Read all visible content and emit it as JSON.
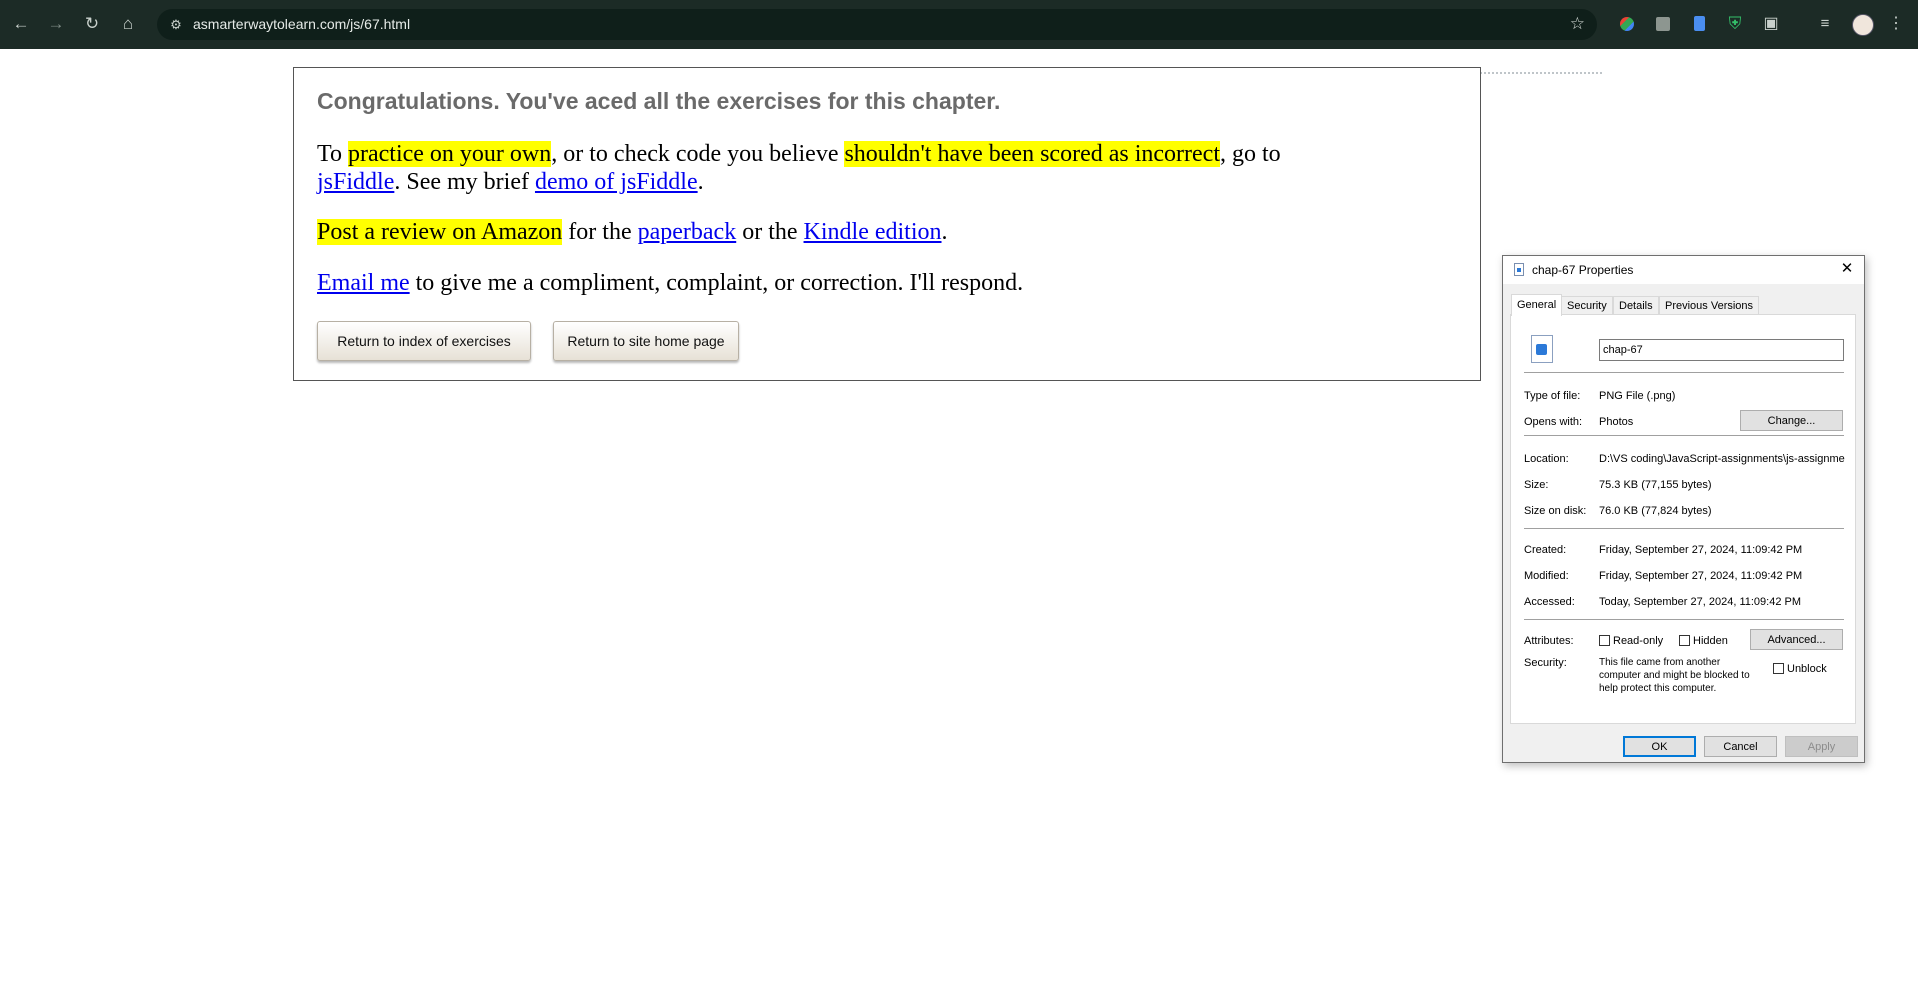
{
  "browser": {
    "url": "asmarterwaytolearn.com/js/67.html",
    "nav_icons": [
      "back-arrow-icon",
      "forward-arrow-icon",
      "reload-icon",
      "home-icon"
    ],
    "extensions": [
      "google-lens-icon",
      "extension-gray-icon",
      "docs-extension-icon",
      "shield-extension-icon",
      "puzzle-extensions-icon",
      "reading-list-icon",
      "profile-avatar",
      "kebab-menu-icon"
    ]
  },
  "page": {
    "heading": "Congratulations. You've aced all the exercises for this chapter.",
    "p1": {
      "t1": "To ",
      "h1": "practice on your own",
      "t2": ", or to check code you believe ",
      "h2": "shouldn't have been scored as incorrect",
      "t3": ", go to",
      "link_jsfiddle": "jsFiddle",
      "t4": ". See my brief ",
      "link_demo": "demo of jsFiddle",
      "t5": "."
    },
    "p2": {
      "h1": "Post a review on Amazon",
      "t1": " for the ",
      "link_paperback": "paperback",
      "t2": " or the ",
      "link_kindle": "Kindle edition",
      "t3": "."
    },
    "p3": {
      "link_email": "Email me",
      "t1": " to give me a compliment, complaint, or correction. I'll respond."
    },
    "buttons": {
      "index": "Return to index of exercises",
      "home": "Return to site home page"
    },
    "highlight_color": "#ffff00",
    "link_color": "#0000ee"
  },
  "dialog": {
    "title": "chap-67 Properties",
    "tabs": [
      "General",
      "Security",
      "Details",
      "Previous Versions"
    ],
    "active_tab": "General",
    "file_name": "chap-67",
    "type_label": "Type of file:",
    "type_value": "PNG File (.png)",
    "opens_label": "Opens with:",
    "opens_value": "Photos",
    "change_button": "Change...",
    "location_label": "Location:",
    "location_value": "D:\\VS coding\\JavaScript-assignments\\js-assignmen",
    "size_label": "Size:",
    "size_value": "75.3 KB (77,155 bytes)",
    "disk_label": "Size on disk:",
    "disk_value": "76.0 KB (77,824 bytes)",
    "created_label": "Created:",
    "created_value": "Friday, September 27, 2024, 11:09:42 PM",
    "modified_label": "Modified:",
    "modified_value": "Friday, September 27, 2024, 11:09:42 PM",
    "accessed_label": "Accessed:",
    "accessed_value": "Today, September 27, 2024, 11:09:42 PM",
    "attributes_label": "Attributes:",
    "readonly_label": "Read-only",
    "hidden_label": "Hidden",
    "advanced_button": "Advanced...",
    "security_label": "Security:",
    "security_text": "This file came from another computer and might be blocked to help protect this computer.",
    "unblock_label": "Unblock",
    "ok_button": "OK",
    "cancel_button": "Cancel",
    "apply_button": "Apply"
  }
}
